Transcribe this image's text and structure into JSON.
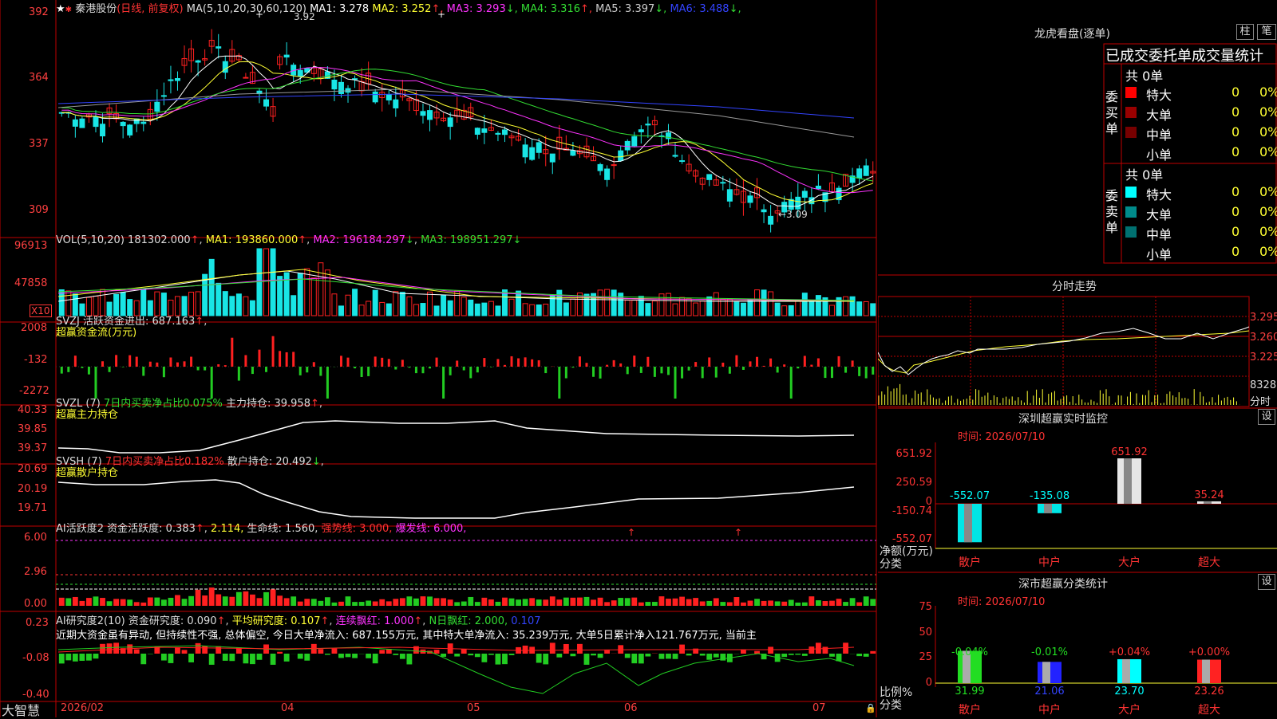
{
  "colors": {
    "up": "#ff2020",
    "down": "#19e5e5",
    "ma1": "#ffffff",
    "ma2": "#ffff33",
    "ma3": "#ff33ff",
    "ma4": "#33dd33",
    "ma5": "#9a9a9a",
    "ma6": "#3344ff",
    "grid": "#c00000",
    "axis": "#ff3333"
  },
  "main": {
    "title_stock": "秦港股份",
    "title_mode": "(日线, 前复权)",
    "ma_params": "MA(5,10,20,30,60,120)",
    "ma_values": [
      {
        "label": "MA1: 3.278",
        "color": "#ffffff",
        "arrow": ""
      },
      {
        "label": "MA2: 3.252",
        "color": "#ffff33",
        "arrow": "↑"
      },
      {
        "label": "MA3: 3.293",
        "color": "#ff33ff",
        "arrow": "↓"
      },
      {
        "label": "MA4: 3.316",
        "color": "#33dd33",
        "arrow": "↑"
      },
      {
        "label": "MA5: 3.397",
        "color": "#cccccc",
        "arrow": "↓"
      },
      {
        "label": "MA6: 3.488",
        "color": "#3344ff",
        "arrow": "↓"
      }
    ],
    "y_ticks": [
      "392",
      "364",
      "337",
      "309"
    ],
    "high_mark": "3.92",
    "low_mark": "←3.09"
  },
  "vol": {
    "title": "VOL(5,10,20)",
    "value": "181302.000",
    "ma1": "MA1: 193860.000",
    "ma2": "MA2: 196184.297",
    "ma3": "MA3: 198951.297",
    "y_ticks": [
      "96913",
      "47858"
    ],
    "unit": "X10"
  },
  "svzj": {
    "title": "SVZJ  活跃资金进出: 687.163",
    "subtitle": "超赢资金流(万元)",
    "y_ticks": [
      "2008",
      "-132",
      "-2272"
    ]
  },
  "svzl": {
    "title": "SVZL (7)",
    "ratio": "7日内买卖净占比0.075%",
    "hold": "主力持仓: 39.958",
    "subtitle": "超赢主力持仓",
    "y_ticks": [
      "40.33",
      "39.85",
      "39.37"
    ]
  },
  "svsh": {
    "title": "SVSH (7)",
    "ratio": "7日内买卖净占比0.182%",
    "hold": "散户持仓: 20.492",
    "subtitle": "超赢散户持仓",
    "y_ticks": [
      "20.69",
      "20.19",
      "19.71"
    ]
  },
  "ai1": {
    "title": "AI活跃度2",
    "v1": "资金活跃度: 0.383",
    "v2": "2.114,",
    "v3": "生命线: 1.560,",
    "v4": "强势线: 3.000,",
    "v5": "爆发线: 6.000,",
    "y_ticks": [
      "6.00",
      "2.96",
      "0.00"
    ]
  },
  "ai2": {
    "title": "AI研究度2(10)",
    "v1": "资金研究度: 0.090",
    "v2": "平均研究度: 0.107",
    "v3": "连续飘红: 1.000",
    "v4": "N日飘红: 2.000,",
    "v5": "0.107",
    "comment": "近期大资金虽有异动, 但持续性不强, 总体偏空, 今日大单净流入: 687.155万元, 其中特大单净流入: 35.239万元, 大单5日累计净入121.767万元, 当前主",
    "y_ticks": [
      "0.23",
      "-0.08",
      "-0.40"
    ]
  },
  "xaxis": {
    "brand": "大智慧",
    "labels": [
      "2026/02",
      "04",
      "05",
      "06",
      "07"
    ]
  },
  "right": {
    "lhb_title": "龙虎看盘(逐单)",
    "btn_col": "柱",
    "btn_bi": "笔",
    "stat_title": "已成交委托单成交量统计",
    "buy_total": "共 0单",
    "buy_label": "委买单",
    "sell_total": "共 0单",
    "sell_label": "委卖单",
    "buy_rows": [
      {
        "name": "特大",
        "color": "#ff0000",
        "val": "0",
        "pct": "0%"
      },
      {
        "name": "大单",
        "color": "#990000",
        "val": "0",
        "pct": "0%"
      },
      {
        "name": "中单",
        "color": "#770000",
        "val": "0",
        "pct": "0%"
      },
      {
        "name": "小单",
        "color": "",
        "val": "0",
        "pct": "0%"
      }
    ],
    "sell_rows": [
      {
        "name": "特大",
        "color": "#00ffff",
        "val": "0",
        "pct": "0%"
      },
      {
        "name": "大单",
        "color": "#008b8b",
        "val": "0",
        "pct": "0%"
      },
      {
        "name": "中单",
        "color": "#007070",
        "val": "0",
        "pct": "0%"
      },
      {
        "name": "小单",
        "color": "",
        "val": "0",
        "pct": "0%"
      }
    ],
    "fs_title": "分时走势",
    "fs_prices": [
      "3.295",
      "3.260",
      "3.225"
    ],
    "fs_vol": "8328",
    "fs_unit": "分时",
    "mon_title": "深圳超赢实时监控",
    "mon_btn": "设",
    "mon_time": "时间: 2026/07/10",
    "mon_y": [
      "651.92",
      "250.59",
      "0",
      "-150.74",
      "-552.07"
    ],
    "mon_ylabel": "净额(万元)",
    "mon_xlabel": "分类",
    "mon_bars": [
      {
        "cat": "散户",
        "value": -552.07,
        "label": "-552.07",
        "color": "#00ffff"
      },
      {
        "cat": "中户",
        "value": -135.08,
        "label": "-135.08",
        "color": "#00ffff"
      },
      {
        "cat": "大户",
        "value": 651.92,
        "label": "651.92",
        "color": "#ffffff"
      },
      {
        "cat": "超大",
        "value": 35.24,
        "label": "35.24",
        "color": "#ffffff"
      }
    ],
    "cls_title": "深市超赢分类统计",
    "cls_btn": "设",
    "cls_time": "时间: 2026/07/10",
    "cls_y": [
      "75",
      "50",
      "25",
      "0"
    ],
    "cls_ylabel": "比例%",
    "cls_xlabel": "分类",
    "cls_bars": [
      {
        "cat": "散户",
        "value": 31.99,
        "label": "31.99",
        "delta": "-0.04%",
        "color": "#22dd22",
        "dcolor": "#22dd22"
      },
      {
        "cat": "中户",
        "value": 21.06,
        "label": "21.06",
        "delta": "-0.01%",
        "color": "#2222ff",
        "dcolor": "#22dd22"
      },
      {
        "cat": "大户",
        "value": 23.7,
        "label": "23.70",
        "delta": "+0.04%",
        "color": "#00ffff",
        "dcolor": "#ff3333"
      },
      {
        "cat": "超大",
        "value": 23.26,
        "label": "23.26",
        "delta": "+0.00%",
        "color": "#ff2222",
        "dcolor": "#ff3333"
      }
    ]
  }
}
